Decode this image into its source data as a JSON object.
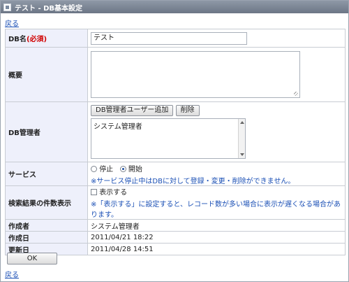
{
  "window": {
    "title": "テスト - DB基本設定",
    "icon": "app-window-icon"
  },
  "nav": {
    "back_top": "戻る",
    "back_bottom": "戻る"
  },
  "form": {
    "db_name": {
      "label": "DB名",
      "required_mark": "(必須)",
      "value": "テスト"
    },
    "description": {
      "label": "概要",
      "value": ""
    },
    "admins": {
      "label": "DB管理者",
      "add_button": "DB管理者ユーザー追加",
      "delete_button": "削除",
      "items": [
        "システム管理者"
      ]
    },
    "service": {
      "label": "サービス",
      "options": [
        "停止",
        "開始"
      ],
      "selected": "開始",
      "note": "※サービス停止中はDBに対して登録・変更・削除ができません。"
    },
    "show_count": {
      "label": "検索結果の件数表示",
      "checkbox_label": "表示する",
      "checked": false,
      "note": "※「表示する」に設定すると、レコード数が多い場合に表示が遅くなる場合があります。"
    },
    "creator": {
      "label": "作成者",
      "value": "システム管理者"
    },
    "created": {
      "label": "作成日",
      "value": "2011/04/21 18:22"
    },
    "updated": {
      "label": "更新日",
      "value": "2011/04/28 14:51"
    }
  },
  "actions": {
    "ok": "OK"
  },
  "colors": {
    "label_bg": "#eef0fb",
    "link": "#1a4fb5",
    "required": "#d00000",
    "titlebar": "#7b8595"
  }
}
